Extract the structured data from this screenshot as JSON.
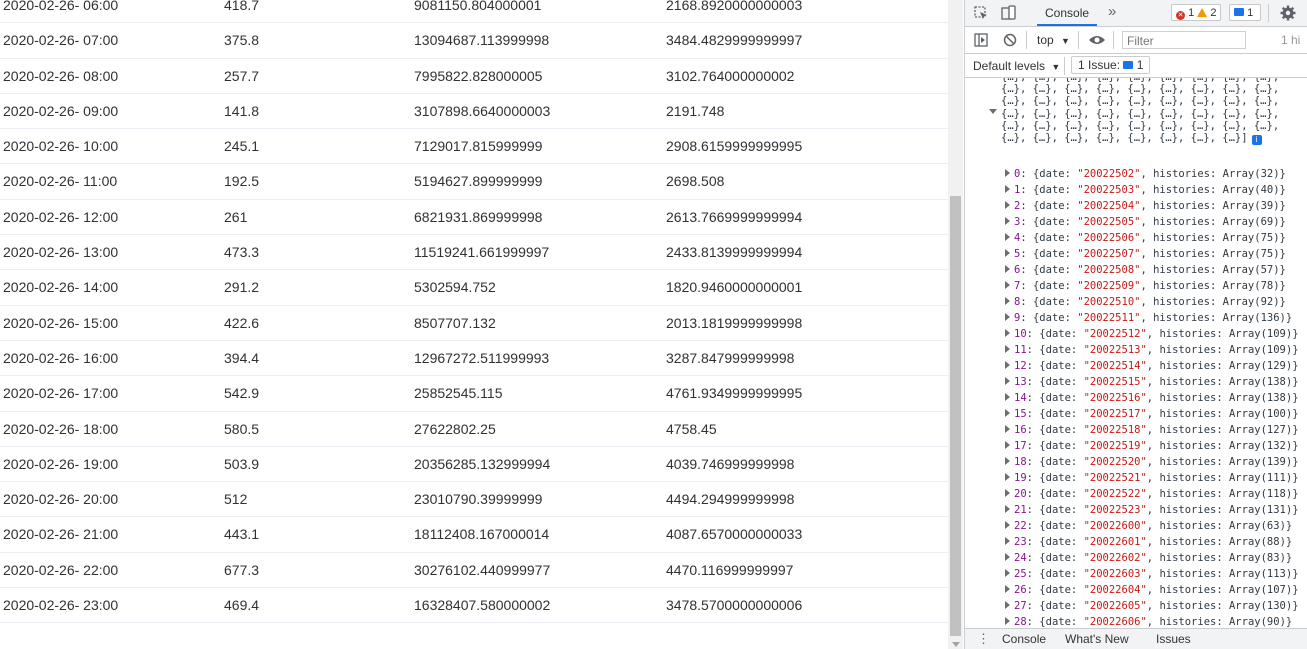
{
  "table": {
    "rows": [
      [
        "2020-02-26- 06:00",
        "418.7",
        "9081150.804000001",
        "2168.8920000000003"
      ],
      [
        "2020-02-26- 07:00",
        "375.8",
        "13094687.113999998",
        "3484.4829999999997"
      ],
      [
        "2020-02-26- 08:00",
        "257.7",
        "7995822.828000005",
        "3102.764000000002"
      ],
      [
        "2020-02-26- 09:00",
        "141.8",
        "3107898.6640000003",
        "2191.748"
      ],
      [
        "2020-02-26- 10:00",
        "245.1",
        "7129017.815999999",
        "2908.6159999999995"
      ],
      [
        "2020-02-26- 11:00",
        "192.5",
        "5194627.899999999",
        "2698.508"
      ],
      [
        "2020-02-26- 12:00",
        "261",
        "6821931.869999998",
        "2613.7669999999994"
      ],
      [
        "2020-02-26- 13:00",
        "473.3",
        "11519241.661999997",
        "2433.8139999999994"
      ],
      [
        "2020-02-26- 14:00",
        "291.2",
        "5302594.752",
        "1820.9460000000001"
      ],
      [
        "2020-02-26- 15:00",
        "422.6",
        "8507707.132",
        "2013.1819999999998"
      ],
      [
        "2020-02-26- 16:00",
        "394.4",
        "12967272.511999993",
        "3287.847999999998"
      ],
      [
        "2020-02-26- 17:00",
        "542.9",
        "25852545.115",
        "4761.9349999999995"
      ],
      [
        "2020-02-26- 18:00",
        "580.5",
        "27622802.25",
        "4758.45"
      ],
      [
        "2020-02-26- 19:00",
        "503.9",
        "20356285.132999994",
        "4039.746999999998"
      ],
      [
        "2020-02-26- 20:00",
        "512",
        "23010790.39999999",
        "4494.294999999998"
      ],
      [
        "2020-02-26- 21:00",
        "443.1",
        "18112408.167000014",
        "4087.6570000000033"
      ],
      [
        "2020-02-26- 22:00",
        "677.3",
        "30276102.440999977",
        "4470.116999999997"
      ],
      [
        "2020-02-26- 23:00",
        "469.4",
        "16328407.580000002",
        "3478.5700000000006"
      ]
    ]
  },
  "devtools": {
    "tabs": {
      "console_label": "Console",
      "more_label": "»"
    },
    "badges": {
      "errors": "1",
      "warnings": "2",
      "messages": "1"
    },
    "toolbar": {
      "context": "top",
      "filter_placeholder": "Filter",
      "hidden_text": "1 hi"
    },
    "levels": {
      "label": "Default levels",
      "issue_label": "1 Issue:",
      "issue_count": "1"
    },
    "console": {
      "collapsed_line": "{…}, {…}, {…}, {…}, {…}, {…}, {…}, {…}, {…},",
      "collapsed_last": "{…}, {…}, {…}, {…}, {…}, {…}, {…}, {…}]",
      "info_badge": "i",
      "entries": [
        {
          "index": "0",
          "date": "20022502",
          "count": "32"
        },
        {
          "index": "1",
          "date": "20022503",
          "count": "40"
        },
        {
          "index": "2",
          "date": "20022504",
          "count": "39"
        },
        {
          "index": "3",
          "date": "20022505",
          "count": "69"
        },
        {
          "index": "4",
          "date": "20022506",
          "count": "75"
        },
        {
          "index": "5",
          "date": "20022507",
          "count": "75"
        },
        {
          "index": "6",
          "date": "20022508",
          "count": "57"
        },
        {
          "index": "7",
          "date": "20022509",
          "count": "78"
        },
        {
          "index": "8",
          "date": "20022510",
          "count": "92"
        },
        {
          "index": "9",
          "date": "20022511",
          "count": "136"
        },
        {
          "index": "10",
          "date": "20022512",
          "count": "109"
        },
        {
          "index": "11",
          "date": "20022513",
          "count": "109"
        },
        {
          "index": "12",
          "date": "20022514",
          "count": "129"
        },
        {
          "index": "13",
          "date": "20022515",
          "count": "138"
        },
        {
          "index": "14",
          "date": "20022516",
          "count": "138"
        },
        {
          "index": "15",
          "date": "20022517",
          "count": "100"
        },
        {
          "index": "16",
          "date": "20022518",
          "count": "127"
        },
        {
          "index": "17",
          "date": "20022519",
          "count": "132"
        },
        {
          "index": "18",
          "date": "20022520",
          "count": "139"
        },
        {
          "index": "19",
          "date": "20022521",
          "count": "111"
        },
        {
          "index": "20",
          "date": "20022522",
          "count": "118"
        },
        {
          "index": "21",
          "date": "20022523",
          "count": "131"
        },
        {
          "index": "22",
          "date": "20022600",
          "count": "63"
        },
        {
          "index": "23",
          "date": "20022601",
          "count": "88"
        },
        {
          "index": "24",
          "date": "20022602",
          "count": "83"
        },
        {
          "index": "25",
          "date": "20022603",
          "count": "113"
        },
        {
          "index": "26",
          "date": "20022604",
          "count": "107"
        },
        {
          "index": "27",
          "date": "20022605",
          "count": "130"
        },
        {
          "index": "28",
          "date": "20022606",
          "count": "90"
        }
      ]
    },
    "drawer": {
      "tabs": [
        "Console",
        "What's New",
        "Issues"
      ]
    }
  },
  "colors": {
    "accent": "#1a73e8",
    "error": "#d93025",
    "warning": "#f29900",
    "key": "#881391",
    "string": "#c41a16"
  }
}
